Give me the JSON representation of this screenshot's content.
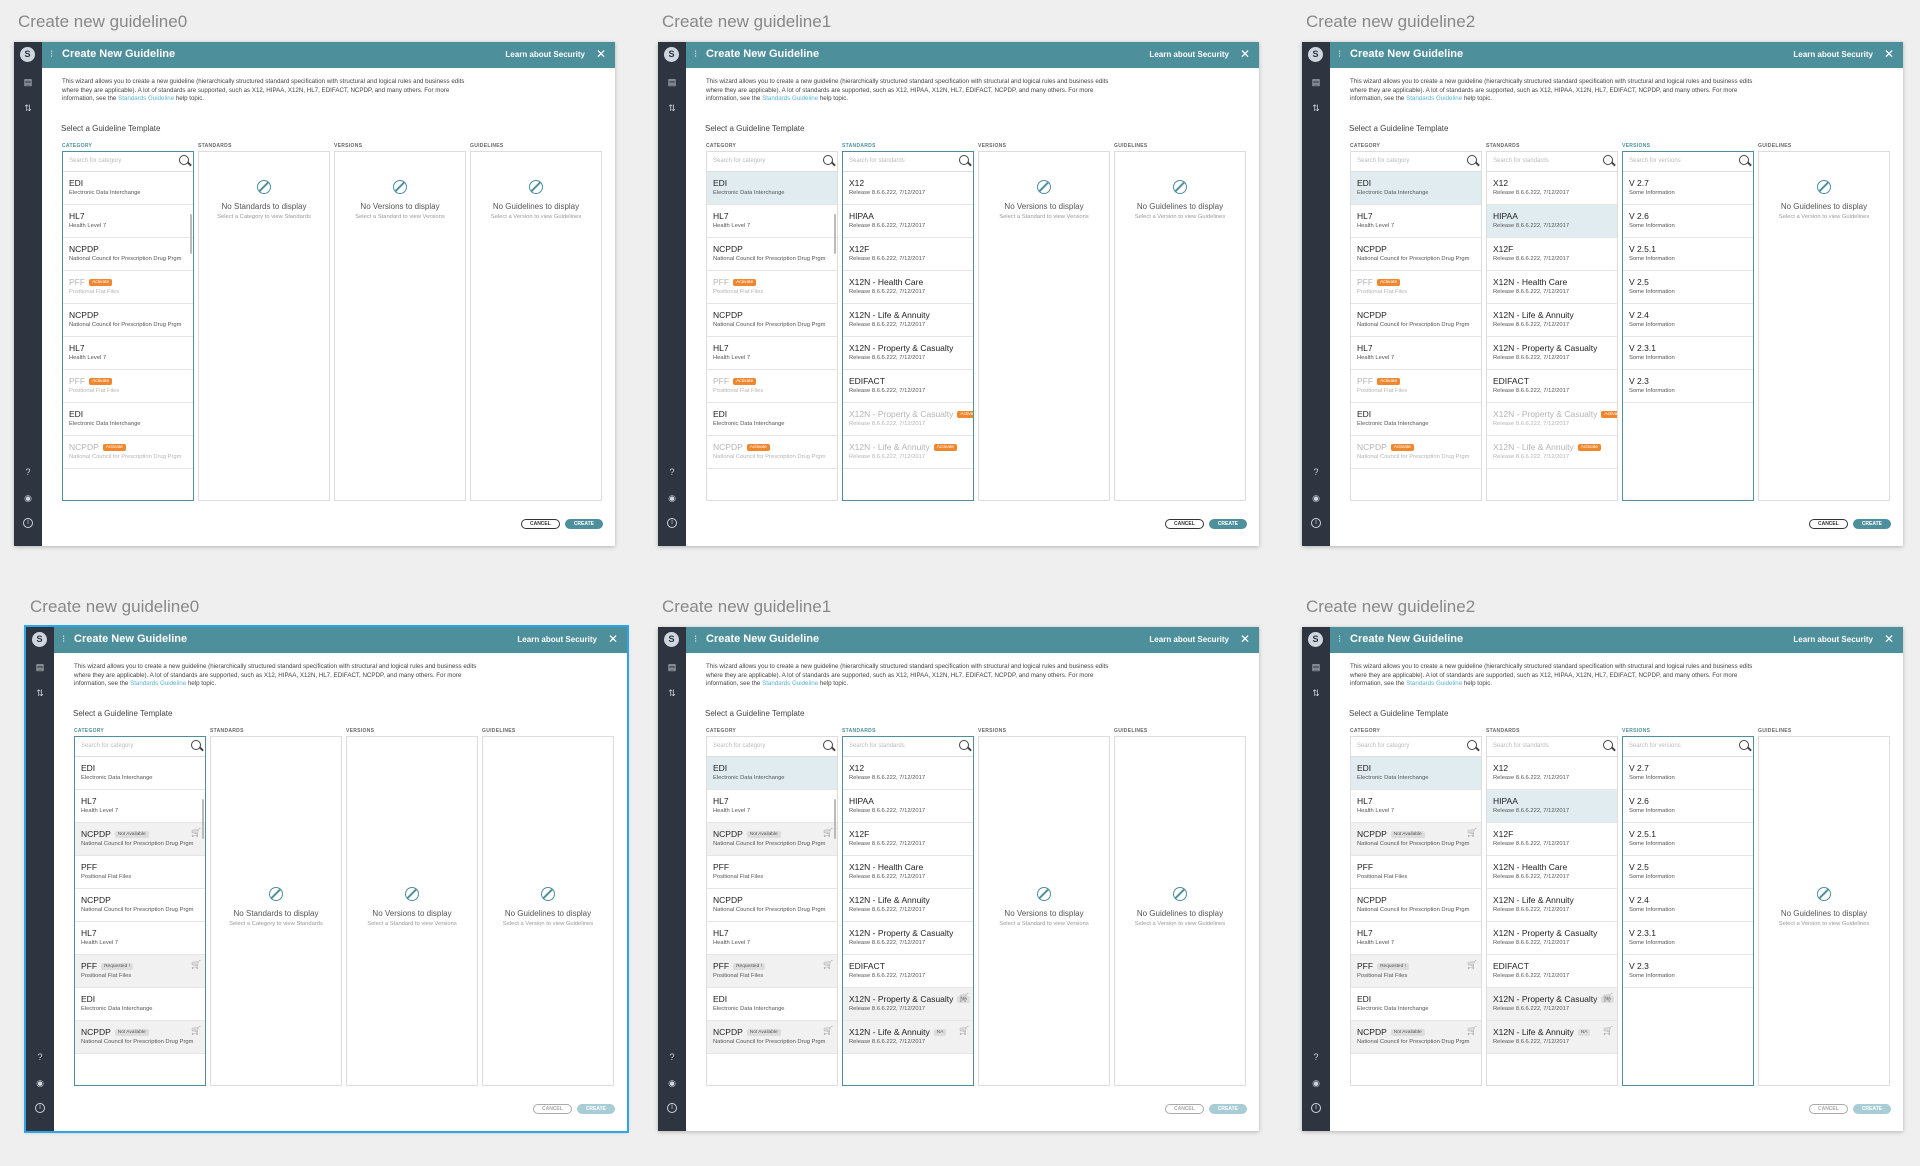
{
  "frames": [
    {
      "title": "Create new guideline0",
      "sel": false,
      "activeCol": 0,
      "catVariant": "a",
      "stdFilled": false,
      "verFilled": false,
      "createDisabled": false
    },
    {
      "title": "Create new guideline1",
      "sel": false,
      "activeCol": 1,
      "catVariant": "a",
      "stdFilled": true,
      "verFilled": false,
      "createDisabled": false
    },
    {
      "title": "Create new guideline2",
      "sel": false,
      "activeCol": 2,
      "catVariant": "a",
      "stdFilled": true,
      "verFilled": true,
      "createDisabled": false
    },
    {
      "title": "Create new guideline0",
      "sel": true,
      "activeCol": 0,
      "catVariant": "b",
      "stdFilled": false,
      "verFilled": false,
      "createDisabled": true
    },
    {
      "title": "Create new guideline1",
      "sel": false,
      "activeCol": 1,
      "catVariant": "b",
      "stdFilled": true,
      "verFilled": false,
      "createDisabled": true
    },
    {
      "title": "Create new guideline2",
      "sel": false,
      "activeCol": 2,
      "catVariant": "b",
      "stdFilled": true,
      "verFilled": true,
      "createDisabled": true
    }
  ],
  "dialog": {
    "title": "Create New Guideline",
    "learn": "Learn about Security",
    "intro_1": "This wizard allows you to create a new guideline (hierarchically structured standard specification with structural and logical rules and business edits where they are applicable). A lot of standards are supported, such as X12, HIPAA, X12N, HL7, EDIFACT, NCPDP, and many others. For more information, see the ",
    "intro_link": "Standards Guideline",
    "intro_2": " help topic.",
    "select": "Select a Guideline Template",
    "cancel": "CANCEL",
    "create": "CREATE"
  },
  "columns": {
    "category": {
      "label": "CATEGORY",
      "search": "Search for category"
    },
    "standards": {
      "label": "STANDARDS",
      "search": "Search for standards",
      "empty": "No Standards to display",
      "hint": "Select a Category to view Standards"
    },
    "versions": {
      "label": "VERSIONS",
      "search": "Search for versions",
      "empty": "No Versions to display",
      "hint": "Select a Standard to view Versions"
    },
    "guidelines": {
      "label": "GUIDELINES",
      "empty": "No Guidelines to display",
      "hint": "Select a Version to view Guidelines"
    }
  },
  "tags": {
    "activate": "Activate",
    "na": "Not Available",
    "requested": "Requested !",
    "na_short": "NA"
  },
  "categories_a": [
    {
      "n": "EDI",
      "d": "Electronic Data Interchange"
    },
    {
      "n": "HL7",
      "d": "Health Level 7"
    },
    {
      "n": "NCPDP",
      "d": "National Council for Prescription Drug Prgm"
    },
    {
      "n": "PFF",
      "d": "Positional Flat Files",
      "tag": "activate",
      "dis": true
    },
    {
      "n": "NCPDP",
      "d": "National Council for Prescription Drug Prgm"
    },
    {
      "n": "HL7",
      "d": "Health Level 7"
    },
    {
      "n": "PFF",
      "d": "Positional Flat Files",
      "tag": "activate",
      "dis": true
    },
    {
      "n": "EDI",
      "d": "Electronic Data Interchange"
    },
    {
      "n": "NCPDP",
      "d": "National Council for Prescription Drug Prgm",
      "tag": "activate",
      "dis": true
    }
  ],
  "categories_b": [
    {
      "n": "EDI",
      "d": "Electronic Data Interchange"
    },
    {
      "n": "HL7",
      "d": "Health Level 7"
    },
    {
      "n": "NCPDP",
      "d": "National Council for Prescription Drug Prgm",
      "tag": "na",
      "cart": true
    },
    {
      "n": "PFF",
      "d": "Positional Flat Files"
    },
    {
      "n": "NCPDP",
      "d": "National Council for Prescription Drug Prgm"
    },
    {
      "n": "HL7",
      "d": "Health Level 7"
    },
    {
      "n": "PFF",
      "d": "Positional Flat Files",
      "tag": "requested",
      "cart": true
    },
    {
      "n": "EDI",
      "d": "Electronic Data Interchange"
    },
    {
      "n": "NCPDP",
      "d": "National Council for Prescription Drug Prgm",
      "tag": "na",
      "cart": true
    }
  ],
  "standards_a": [
    {
      "n": "X12",
      "d": "Release 8.6.6.222, 7/12/2017"
    },
    {
      "n": "HIPAA",
      "d": "Release 8.6.6.222, 7/12/2017"
    },
    {
      "n": "X12F",
      "d": "Release 8.6.6.222, 7/12/2017"
    },
    {
      "n": "X12N - Health Care",
      "d": "Release 8.6.6.222, 7/12/2017"
    },
    {
      "n": "X12N - Life & Annuity",
      "d": "Release 8.6.6.222, 7/12/2017"
    },
    {
      "n": "X12N - Property & Casualty",
      "d": "Release 8.6.6.222, 7/12/2017"
    },
    {
      "n": "EDIFACT",
      "d": "Release 8.6.6.222, 7/12/2017"
    },
    {
      "n": "X12N - Property & Casualty",
      "d": "Release 8.6.6.222, 7/12/2017",
      "tag": "activate",
      "dis": true
    },
    {
      "n": "X12N - Life & Annuity",
      "d": "Release 8.6.6.222, 7/12/2017",
      "tag": "activate",
      "dis": true
    }
  ],
  "standards_b": [
    {
      "n": "X12",
      "d": "Release 8.6.6.222, 7/12/2017"
    },
    {
      "n": "HIPAA",
      "d": "Release 8.6.6.222, 7/12/2017"
    },
    {
      "n": "X12F",
      "d": "Release 8.6.6.222, 7/12/2017"
    },
    {
      "n": "X12N - Health Care",
      "d": "Release 8.6.6.222, 7/12/2017"
    },
    {
      "n": "X12N - Life & Annuity",
      "d": "Release 8.6.6.222, 7/12/2017"
    },
    {
      "n": "X12N - Property & Casualty",
      "d": "Release 8.6.6.222, 7/12/2017"
    },
    {
      "n": "EDIFACT",
      "d": "Release 8.6.6.222, 7/12/2017"
    },
    {
      "n": "X12N - Property & Casualty",
      "d": "Release 8.6.6.222, 7/12/2017",
      "tag": "na_short",
      "cart": true
    },
    {
      "n": "X12N - Life & Annuity",
      "d": "Release 8.6.6.222, 7/12/2017",
      "tag": "na_short",
      "cart": true
    }
  ],
  "versions": [
    {
      "n": "V 2.7",
      "d": "Some Information"
    },
    {
      "n": "V 2.6",
      "d": "Some Information"
    },
    {
      "n": "V 2.5.1",
      "d": "Some Information"
    },
    {
      "n": "V 2.5",
      "d": "Some Information"
    },
    {
      "n": "V 2.4",
      "d": "Some Information"
    },
    {
      "n": "V 2.3.1",
      "d": "Some Information"
    },
    {
      "n": "V 2.3",
      "d": "Some Information"
    }
  ],
  "colors": {
    "header": "#4e8f9c",
    "sidebar": "#2e3440",
    "activate": "#f0872e",
    "selected_row": "#e0ecef"
  },
  "icons": {
    "logo": "S",
    "help": "?",
    "info": "i"
  }
}
